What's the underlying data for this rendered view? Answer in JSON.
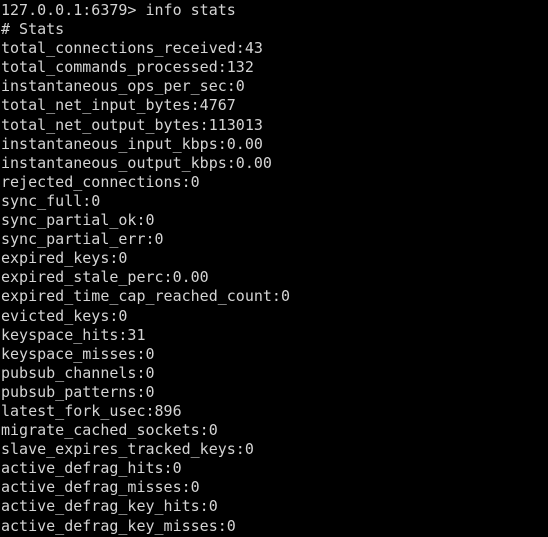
{
  "terminal": {
    "background_color": "#000000",
    "foreground_color": "#d4d4d4",
    "prompt": "127.0.0.1:6379> info stats",
    "section_header": "# Stats",
    "lines": [
      "127.0.0.1:6379> info stats",
      "# Stats",
      "total_connections_received:43",
      "total_commands_processed:132",
      "instantaneous_ops_per_sec:0",
      "total_net_input_bytes:4767",
      "total_net_output_bytes:113013",
      "instantaneous_input_kbps:0.00",
      "instantaneous_output_kbps:0.00",
      "rejected_connections:0",
      "sync_full:0",
      "sync_partial_ok:0",
      "sync_partial_err:0",
      "expired_keys:0",
      "expired_stale_perc:0.00",
      "expired_time_cap_reached_count:0",
      "evicted_keys:0",
      "keyspace_hits:31",
      "keyspace_misses:0",
      "pubsub_channels:0",
      "pubsub_patterns:0",
      "latest_fork_usec:896",
      "migrate_cached_sockets:0",
      "slave_expires_tracked_keys:0",
      "active_defrag_hits:0",
      "active_defrag_misses:0",
      "active_defrag_key_hits:0",
      "active_defrag_key_misses:0"
    ],
    "stats": [
      {
        "key": "total_connections_received",
        "value": "43"
      },
      {
        "key": "total_commands_processed",
        "value": "132"
      },
      {
        "key": "instantaneous_ops_per_sec",
        "value": "0"
      },
      {
        "key": "total_net_input_bytes",
        "value": "4767"
      },
      {
        "key": "total_net_output_bytes",
        "value": "113013"
      },
      {
        "key": "instantaneous_input_kbps",
        "value": "0.00"
      },
      {
        "key": "instantaneous_output_kbps",
        "value": "0.00"
      },
      {
        "key": "rejected_connections",
        "value": "0"
      },
      {
        "key": "sync_full",
        "value": "0"
      },
      {
        "key": "sync_partial_ok",
        "value": "0"
      },
      {
        "key": "sync_partial_err",
        "value": "0"
      },
      {
        "key": "expired_keys",
        "value": "0"
      },
      {
        "key": "expired_stale_perc",
        "value": "0.00"
      },
      {
        "key": "expired_time_cap_reached_count",
        "value": "0"
      },
      {
        "key": "evicted_keys",
        "value": "0"
      },
      {
        "key": "keyspace_hits",
        "value": "31"
      },
      {
        "key": "keyspace_misses",
        "value": "0"
      },
      {
        "key": "pubsub_channels",
        "value": "0"
      },
      {
        "key": "pubsub_patterns",
        "value": "0"
      },
      {
        "key": "latest_fork_usec",
        "value": "896"
      },
      {
        "key": "migrate_cached_sockets",
        "value": "0"
      },
      {
        "key": "slave_expires_tracked_keys",
        "value": "0"
      },
      {
        "key": "active_defrag_hits",
        "value": "0"
      },
      {
        "key": "active_defrag_misses",
        "value": "0"
      },
      {
        "key": "active_defrag_key_hits",
        "value": "0"
      },
      {
        "key": "active_defrag_key_misses",
        "value": "0"
      }
    ]
  }
}
